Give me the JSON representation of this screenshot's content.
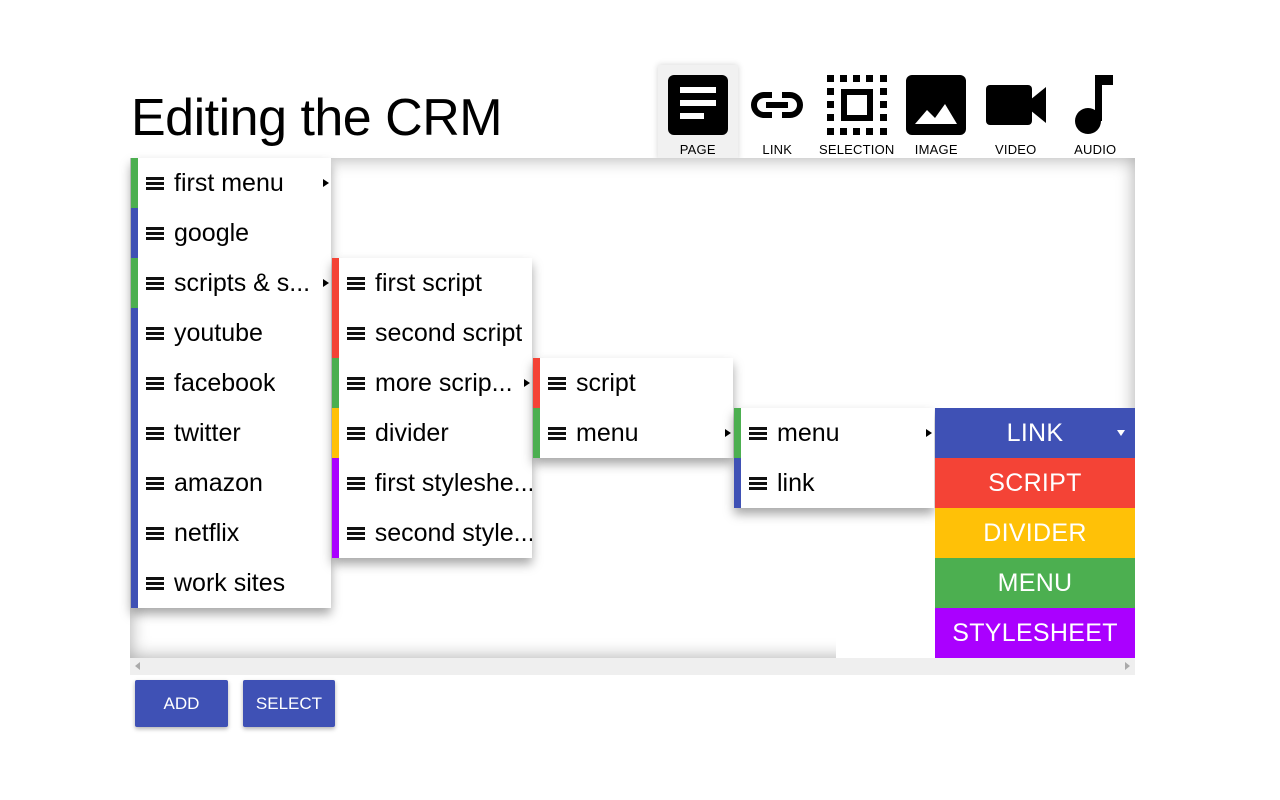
{
  "title": "Editing the CRM",
  "content_types": [
    {
      "label": "PAGE",
      "icon": "page-icon",
      "active": true
    },
    {
      "label": "LINK",
      "icon": "link-icon",
      "active": false
    },
    {
      "label": "SELECTION",
      "icon": "selection-icon",
      "active": false
    },
    {
      "label": "IMAGE",
      "icon": "image-icon",
      "active": false
    },
    {
      "label": "VIDEO",
      "icon": "video-icon",
      "active": false
    },
    {
      "label": "AUDIO",
      "icon": "audio-icon",
      "active": false
    }
  ],
  "colors": {
    "link": "#3f51b5",
    "script": "#f44336",
    "divider": "#ffc107",
    "menu": "#4caf50",
    "stylesheet": "#aa00ff"
  },
  "columns": [
    {
      "items": [
        {
          "name": "first menu",
          "type": "menu",
          "has_children": true
        },
        {
          "name": "google",
          "type": "link"
        },
        {
          "name": "scripts & s...",
          "type": "menu",
          "has_children": true
        },
        {
          "name": "youtube",
          "type": "link"
        },
        {
          "name": "facebook",
          "type": "link"
        },
        {
          "name": "twitter",
          "type": "link"
        },
        {
          "name": "amazon",
          "type": "link"
        },
        {
          "name": "netflix",
          "type": "link"
        },
        {
          "name": "work sites",
          "type": "link"
        }
      ]
    },
    {
      "items": [
        {
          "name": "first script",
          "type": "script"
        },
        {
          "name": "second script",
          "type": "script"
        },
        {
          "name": "more scrip...",
          "type": "menu",
          "has_children": true
        },
        {
          "name": "divider",
          "type": "divider"
        },
        {
          "name": "first styleshe...",
          "type": "stylesheet"
        },
        {
          "name": "second style...",
          "type": "stylesheet"
        }
      ]
    },
    {
      "items": [
        {
          "name": "script",
          "type": "script"
        },
        {
          "name": "menu",
          "type": "menu",
          "has_children": true
        }
      ]
    },
    {
      "items": [
        {
          "name": "menu",
          "type": "menu",
          "has_children": true
        },
        {
          "name": "link",
          "type": "link"
        }
      ]
    }
  ],
  "add_menu": {
    "options": [
      {
        "label": "LINK",
        "type": "link",
        "selected": true
      },
      {
        "label": "SCRIPT",
        "type": "script"
      },
      {
        "label": "DIVIDER",
        "type": "divider"
      },
      {
        "label": "MENU",
        "type": "menu"
      },
      {
        "label": "STYLESHEET",
        "type": "stylesheet"
      }
    ]
  },
  "buttons": {
    "add": "ADD",
    "select": "SELECT"
  }
}
